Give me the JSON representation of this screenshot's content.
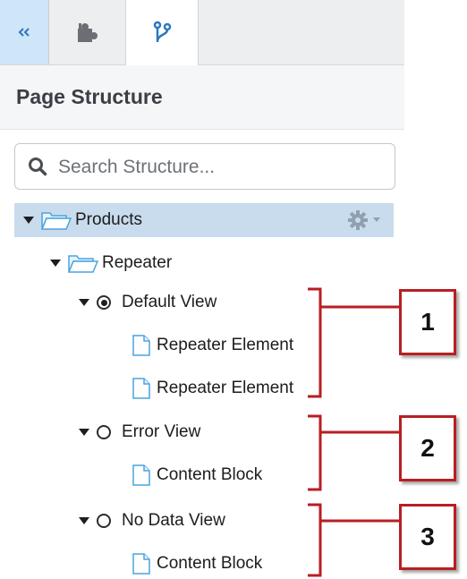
{
  "tabs": [
    {
      "name": "collapse",
      "icon": "double-chevron-left-icon"
    },
    {
      "name": "components",
      "icon": "puzzle-icon"
    },
    {
      "name": "structure",
      "icon": "branch-icon"
    }
  ],
  "header": {
    "title": "Page Structure"
  },
  "search": {
    "placeholder": "Search Structure..."
  },
  "tree": {
    "root": {
      "label": "Products",
      "icon": "folder-icon",
      "selected": true,
      "actions_icon": "gear-icon"
    },
    "repeater": {
      "label": "Repeater",
      "icon": "folder-icon"
    },
    "views": [
      {
        "label": "Default View",
        "radio_selected": true,
        "children": [
          "Repeater Element",
          "Repeater Element"
        ]
      },
      {
        "label": "Error View",
        "radio_selected": false,
        "children": [
          "Content Block"
        ]
      },
      {
        "label": "No Data View",
        "radio_selected": false,
        "children": [
          "Content Block"
        ]
      }
    ]
  },
  "callouts": [
    "1",
    "2",
    "3"
  ],
  "colors": {
    "accent_red": "#b81e23",
    "selected_row": "#c8dcee",
    "active_tab": "#cfe5f8",
    "folder_blue": "#4aa3df"
  }
}
